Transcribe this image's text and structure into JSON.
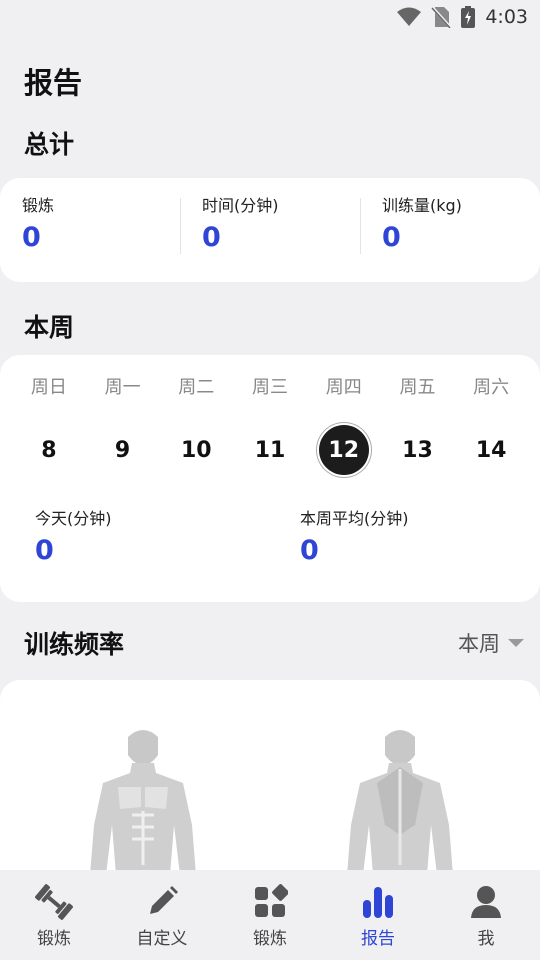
{
  "status_bar": {
    "time": "4:03"
  },
  "page_title": "报告",
  "totals": {
    "title": "总计",
    "items": [
      {
        "label": "锻炼",
        "value": "0"
      },
      {
        "label": "时间(分钟)",
        "value": "0"
      },
      {
        "label": "训练量(kg)",
        "value": "0"
      }
    ]
  },
  "week": {
    "title": "本周",
    "days": [
      "周日",
      "周一",
      "周二",
      "周三",
      "周四",
      "周五",
      "周六"
    ],
    "dates": [
      "8",
      "9",
      "10",
      "11",
      "12",
      "13",
      "14"
    ],
    "selected_date": "12",
    "today_label": "今天(分钟)",
    "today_value": "0",
    "avg_label": "本周平均(分钟)",
    "avg_value": "0"
  },
  "frequency": {
    "title": "训练频率",
    "period": "本周"
  },
  "nav": {
    "items": [
      {
        "label": "锻炼",
        "icon": "dumbbell-icon"
      },
      {
        "label": "自定义",
        "icon": "pencil-icon"
      },
      {
        "label": "锻炼",
        "icon": "grid-icon"
      },
      {
        "label": "报告",
        "icon": "bar-chart-icon"
      },
      {
        "label": "我",
        "icon": "person-icon"
      }
    ],
    "active_index": 3
  },
  "colors": {
    "accent": "#2f45d6",
    "selected_date_bg": "#1c1c1c"
  }
}
